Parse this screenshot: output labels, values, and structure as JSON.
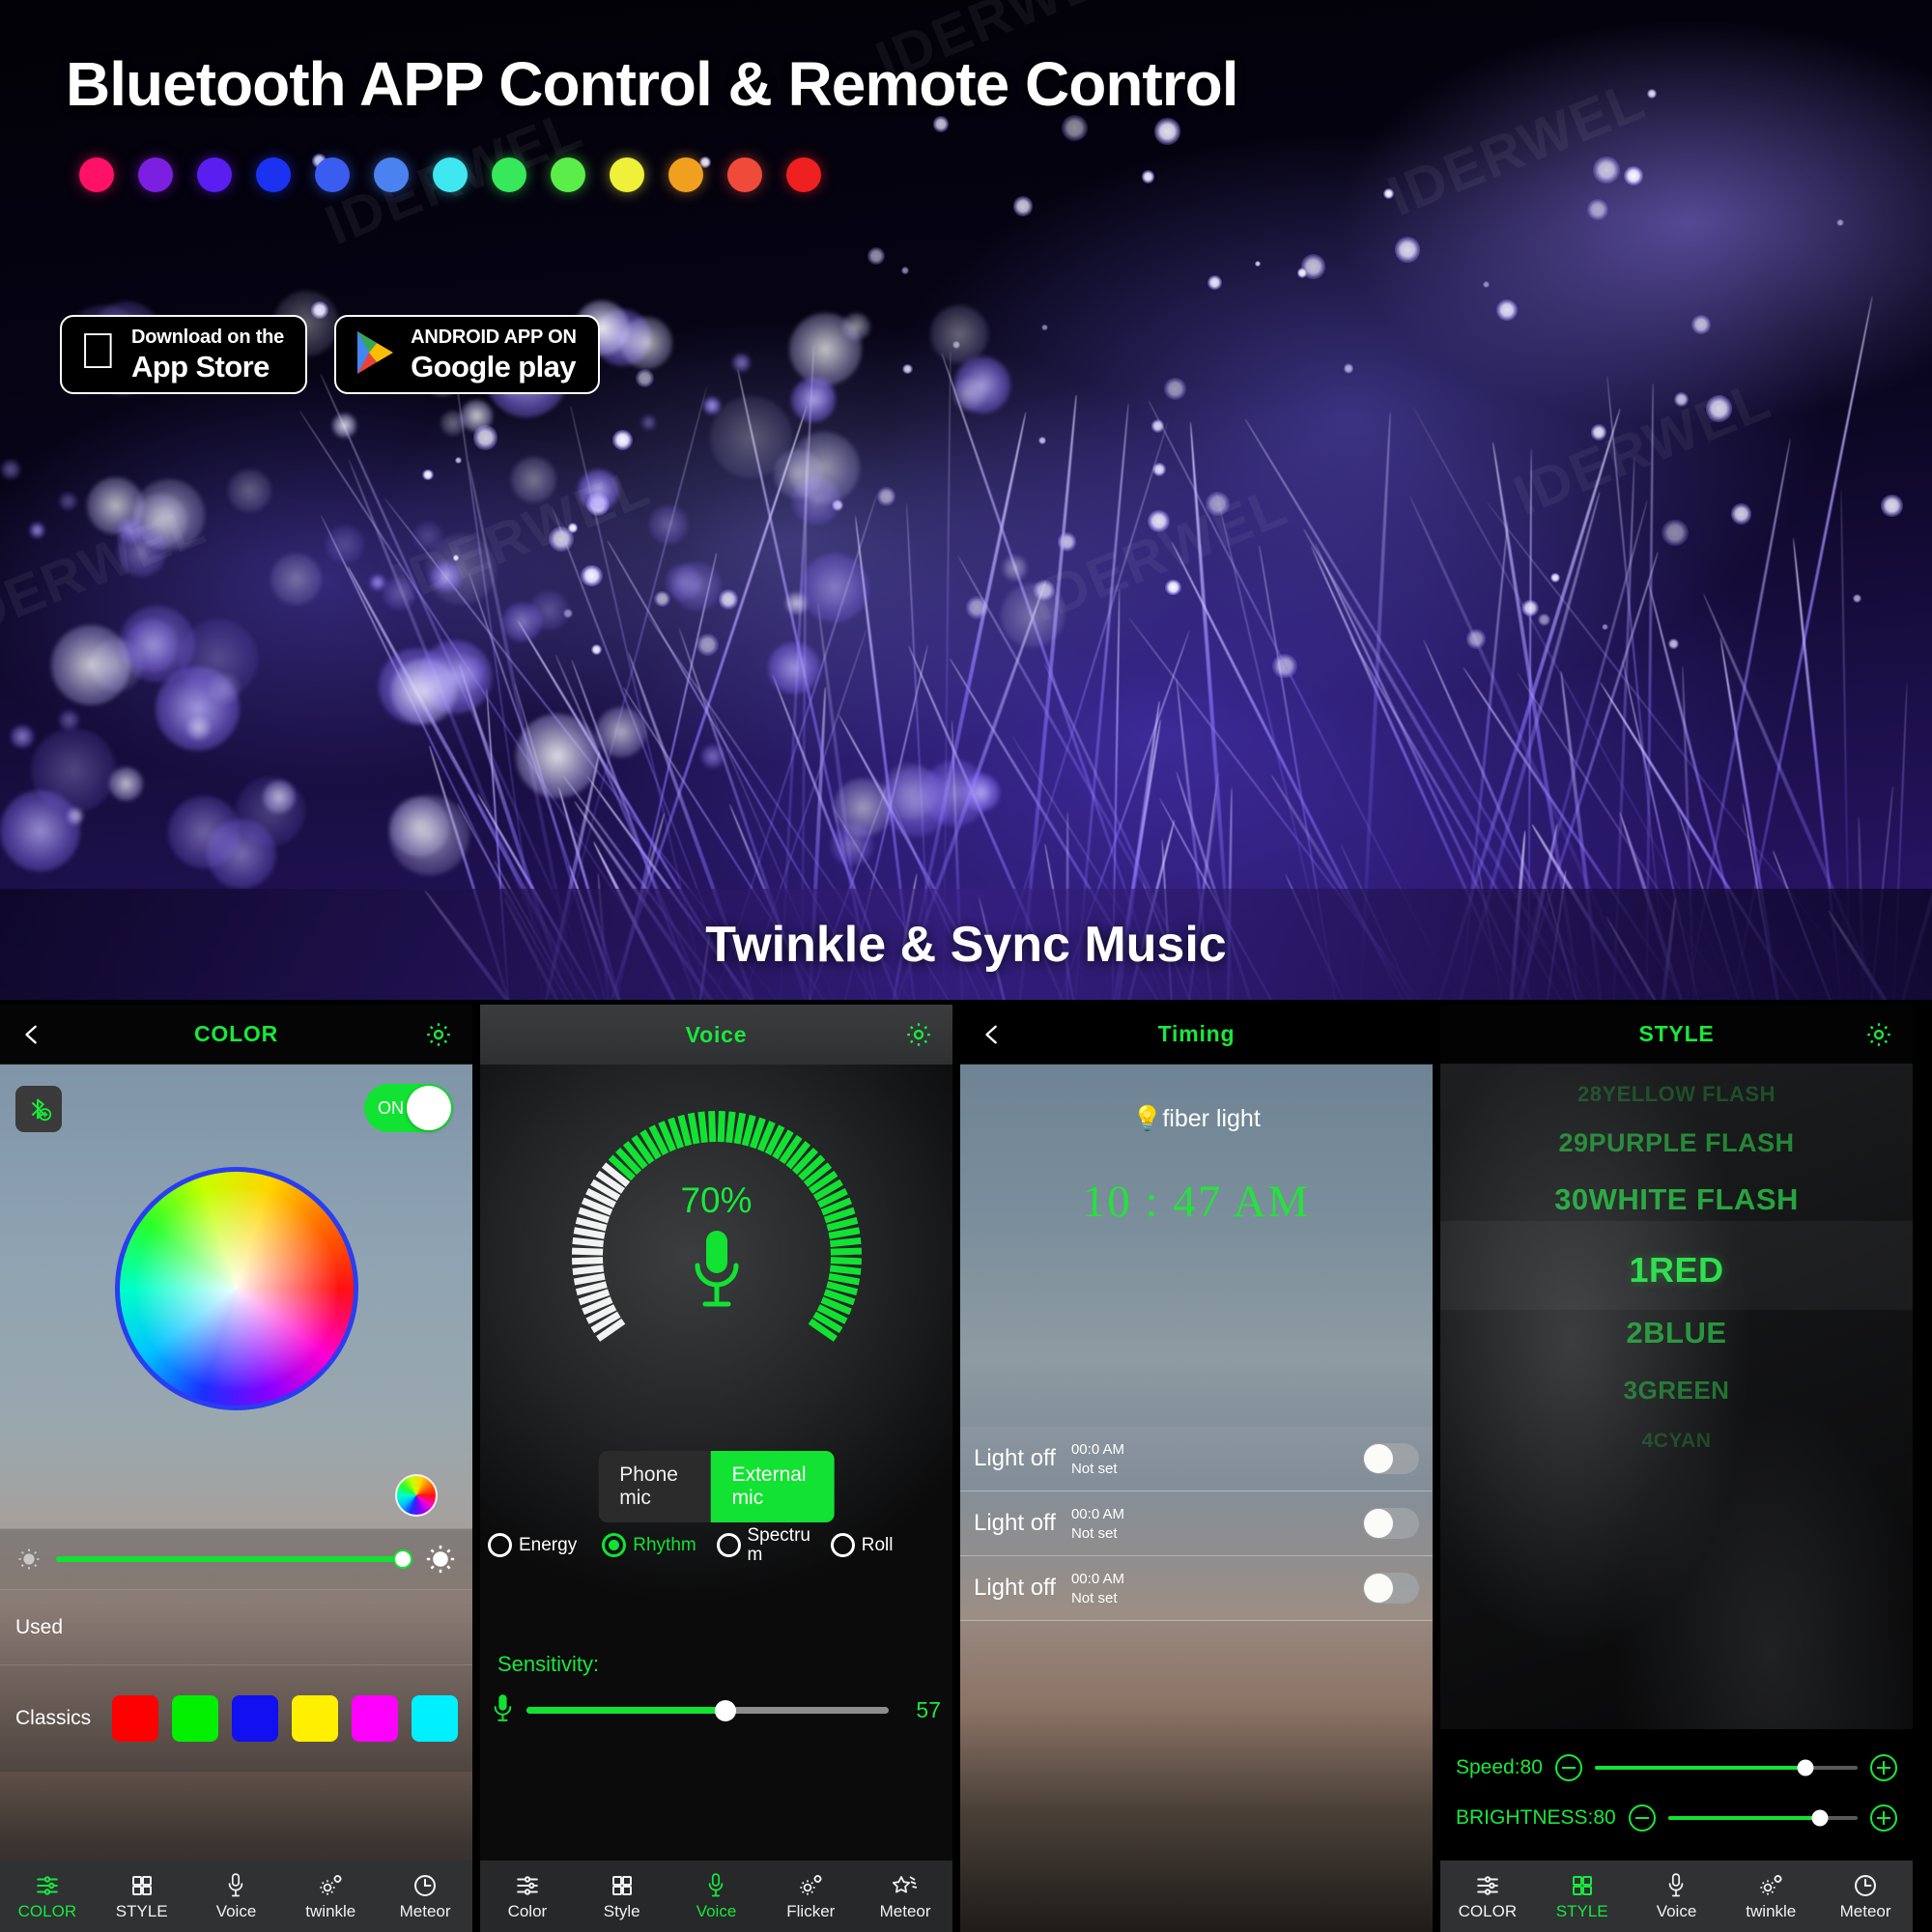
{
  "hero": {
    "title": "Bluetooth APP Control & Remote Control",
    "subtitle": "Twinkle & Sync Music",
    "watermark": "IDERWEL",
    "color_dots": [
      "#ff1166",
      "#7d1fe0",
      "#5a1ef0",
      "#1b33f0",
      "#3a5cf0",
      "#4a83f0",
      "#3fe8f0",
      "#36e85a",
      "#5bee4a",
      "#eef03a",
      "#f0a01e",
      "#f04a3a",
      "#ee2020"
    ],
    "badges": [
      {
        "id": "app-store",
        "small": "Download on the",
        "big": "App Store",
        "icon": "apple-icon"
      },
      {
        "id": "google-play",
        "small": "ANDROID APP ON",
        "big": "Google play",
        "icon": "google-play-icon"
      }
    ]
  },
  "screens": [
    {
      "id": "color",
      "title": "COLOR",
      "has_back": true,
      "has_gear": true,
      "power_toggle": {
        "label": "ON",
        "state": "on"
      },
      "bluetooth_button": "bluetooth-add-icon",
      "brightness_slider": {
        "value": 100,
        "min_icon": "sun-small-icon",
        "max_icon": "sun-large-icon"
      },
      "rows": [
        {
          "label": "Used",
          "swatches": []
        },
        {
          "label": "Classics",
          "swatches": [
            "#ff0000",
            "#00f000",
            "#1010f0",
            "#fff000",
            "#ff00ff",
            "#00f0ff"
          ]
        }
      ],
      "nav": [
        {
          "label": "COLOR",
          "icon": "sliders-icon",
          "active": true
        },
        {
          "label": "STYLE",
          "icon": "grid-icon",
          "active": false
        },
        {
          "label": "Voice",
          "icon": "mic-icon",
          "active": false
        },
        {
          "label": "twinkle",
          "icon": "gear-sparkle-icon",
          "active": false
        },
        {
          "label": "Meteor",
          "icon": "clock-icon",
          "active": false
        }
      ]
    },
    {
      "id": "voice",
      "title": "Voice",
      "has_back": false,
      "has_gear": true,
      "gauge": {
        "percent_label": "70%",
        "percent": 70,
        "icon": "mic-icon"
      },
      "mic_source": {
        "options": [
          "Phone mic",
          "External mic"
        ],
        "selected": "External mic"
      },
      "modes": [
        {
          "label": "Energy",
          "selected": false
        },
        {
          "label": "Rhythm",
          "selected": true
        },
        {
          "label": "Spectru\nm",
          "selected": false
        },
        {
          "label": "Roll",
          "selected": false
        }
      ],
      "sensitivity": {
        "label": "Sensitivity:",
        "value": 57,
        "icon": "mic-icon"
      },
      "nav": [
        {
          "label": "Color",
          "icon": "sliders-icon",
          "active": false
        },
        {
          "label": "Style",
          "icon": "grid-icon",
          "active": false
        },
        {
          "label": "Voice",
          "icon": "mic-icon",
          "active": true
        },
        {
          "label": "Flicker",
          "icon": "gear-sparkle-icon",
          "active": false
        },
        {
          "label": "Meteor",
          "icon": "meteor-icon",
          "active": false
        }
      ]
    },
    {
      "id": "timing",
      "title": "Timing",
      "has_back": true,
      "has_gear": false,
      "device_name": "fiber light",
      "device_icon": "bulb-icon",
      "current_time": "10 : 47 AM",
      "timers": [
        {
          "name": "Light off",
          "time": "00:0 AM",
          "status": "Not set",
          "enabled": false
        },
        {
          "name": "Light off",
          "time": "00:0 AM",
          "status": "Not set",
          "enabled": false
        },
        {
          "name": "Light off",
          "time": "00:0 AM",
          "status": "Not set",
          "enabled": false
        }
      ]
    },
    {
      "id": "style",
      "title": "STYLE",
      "has_back": false,
      "has_gear": true,
      "style_list": [
        {
          "label": "28YELLOW FLASH",
          "selected": false
        },
        {
          "label": "29PURPLE FLASH",
          "selected": false
        },
        {
          "label": "30WHITE FLASH",
          "selected": false
        },
        {
          "label": "1RED",
          "selected": true
        },
        {
          "label": "2BLUE",
          "selected": false
        },
        {
          "label": "3GREEN",
          "selected": false
        },
        {
          "label": "4CYAN",
          "selected": false
        }
      ],
      "sliders": [
        {
          "label": "Speed:80",
          "value": 80
        },
        {
          "label": "BRIGHTNESS:80",
          "value": 80
        }
      ],
      "nav": [
        {
          "label": "COLOR",
          "icon": "sliders-icon",
          "active": false
        },
        {
          "label": "STYLE",
          "icon": "grid-icon",
          "active": true
        },
        {
          "label": "Voice",
          "icon": "mic-icon",
          "active": false
        },
        {
          "label": "twinkle",
          "icon": "gear-sparkle-icon",
          "active": false
        },
        {
          "label": "Meteor",
          "icon": "clock-icon",
          "active": false
        }
      ]
    }
  ],
  "colors": {
    "accent_green": "#19e83c",
    "toggle_green": "#12e232",
    "wheel_border": "#2a3df0"
  }
}
